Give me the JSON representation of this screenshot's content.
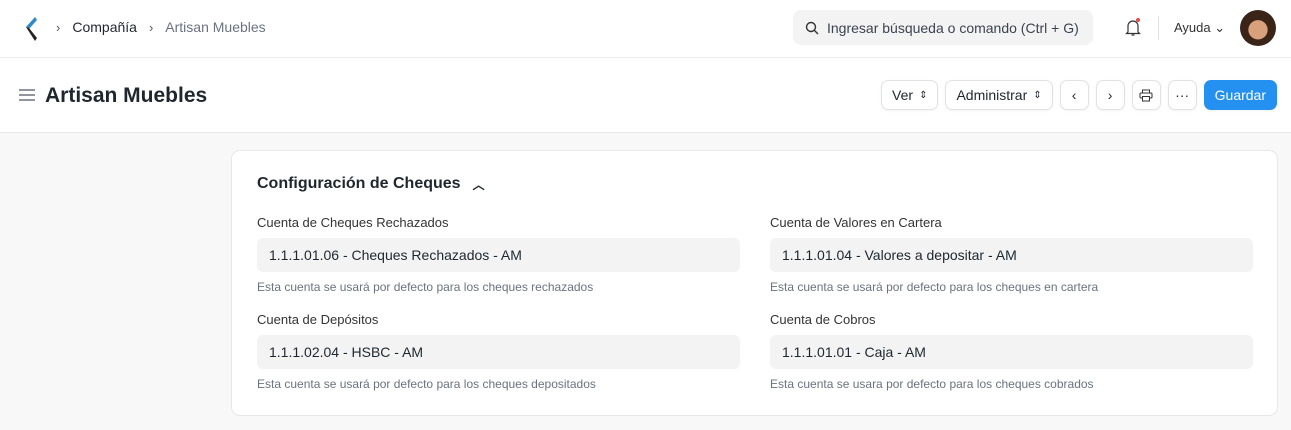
{
  "navbar": {
    "breadcrumbs": [
      "Compañía",
      "Artisan Muebles"
    ],
    "search_placeholder": "Ingresar búsqueda o comando (Ctrl + G)",
    "help": "Ayuda"
  },
  "page": {
    "title": "Artisan Muebles",
    "actions": {
      "view": "Ver",
      "manage": "Administrar",
      "save": "Guardar"
    }
  },
  "section": {
    "title": "Configuración de Cheques",
    "fields": [
      {
        "label": "Cuenta de Cheques Rechazados",
        "value": "1.1.1.01.06 - Cheques Rechazados - AM",
        "description": "Esta cuenta se usará por defecto para los cheques rechazados"
      },
      {
        "label": "Cuenta de Valores en Cartera",
        "value": "1.1.1.01.04 - Valores a depositar - AM",
        "description": "Esta cuenta se usará por defecto para los cheques en cartera"
      },
      {
        "label": "Cuenta de Depósitos",
        "value": "1.1.1.02.04 - HSBC - AM",
        "description": "Esta cuenta se usará por defecto para los cheques depositados"
      },
      {
        "label": "Cuenta de Cobros",
        "value": "1.1.1.01.01 - Caja - AM",
        "description": "Esta cuenta se usara por defecto para los cheques cobrados"
      }
    ]
  }
}
